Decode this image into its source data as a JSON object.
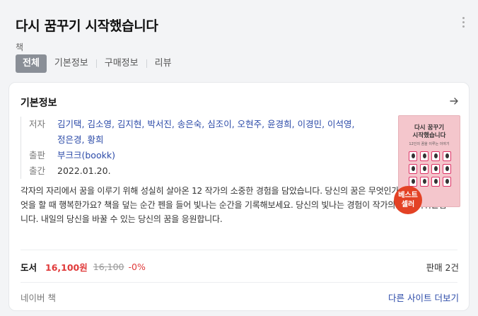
{
  "header": {
    "title": "다시 꿈꾸기 시작했습니다",
    "subtitle": "책",
    "more_icon": "more-vertical-icon"
  },
  "tabs": [
    {
      "label": "전체",
      "active": true
    },
    {
      "label": "기본정보",
      "active": false
    },
    {
      "label": "구매정보",
      "active": false
    },
    {
      "label": "리뷰",
      "active": false
    }
  ],
  "card": {
    "title": "기본정보",
    "arrow_icon": "arrow-right-icon",
    "info": {
      "author_label": "저자",
      "author_line1": "김기택, 김소영, 김지현, 박서진, 송은숙, 심조이, 오현주, 윤경희, 이경민, 이석영,",
      "author_line2": "정은경, 황희",
      "publisher_label": "출판",
      "publisher": "부크크(bookk)",
      "date_label": "출간",
      "date": "2022.01.20."
    },
    "description": "각자의 자리에서 꿈을 이루기 위해 성실히 살아온 12 작가의 소중한 경험을 담았습니다. 당신의 꿈은 무엇인가요? 당신은 무엇을 할 때 행복한가요? 책을 덮는 순간 펜을 들어 빛나는 순간을 기록해보세요. 당신의 빛나는 경험이 작가의 꿈을 이뤄줄겁니다. 내일의 당신을 바꿀 수 있는 당신의 꿈을 응원합니다.",
    "cover": {
      "title_line1": "다시 꿈꾸기",
      "title_line2": "시작했습니다",
      "sub": "12인의 꿈을 이루는 이야기"
    },
    "badge_line1": "베스트",
    "badge_line2": "셀러",
    "price": {
      "label": "도서",
      "sale": "16,100원",
      "original": "16,100",
      "discount": "-0%",
      "sales_count": "판매 2건"
    },
    "footer": {
      "source": "네이버 책",
      "more_sites": "다른 사이트 더보기"
    }
  },
  "colors": {
    "accent_link": "#2b4aa8",
    "price_red": "#e03a3a",
    "badge_red": "#e34225",
    "active_tab": "#8a8f97"
  }
}
